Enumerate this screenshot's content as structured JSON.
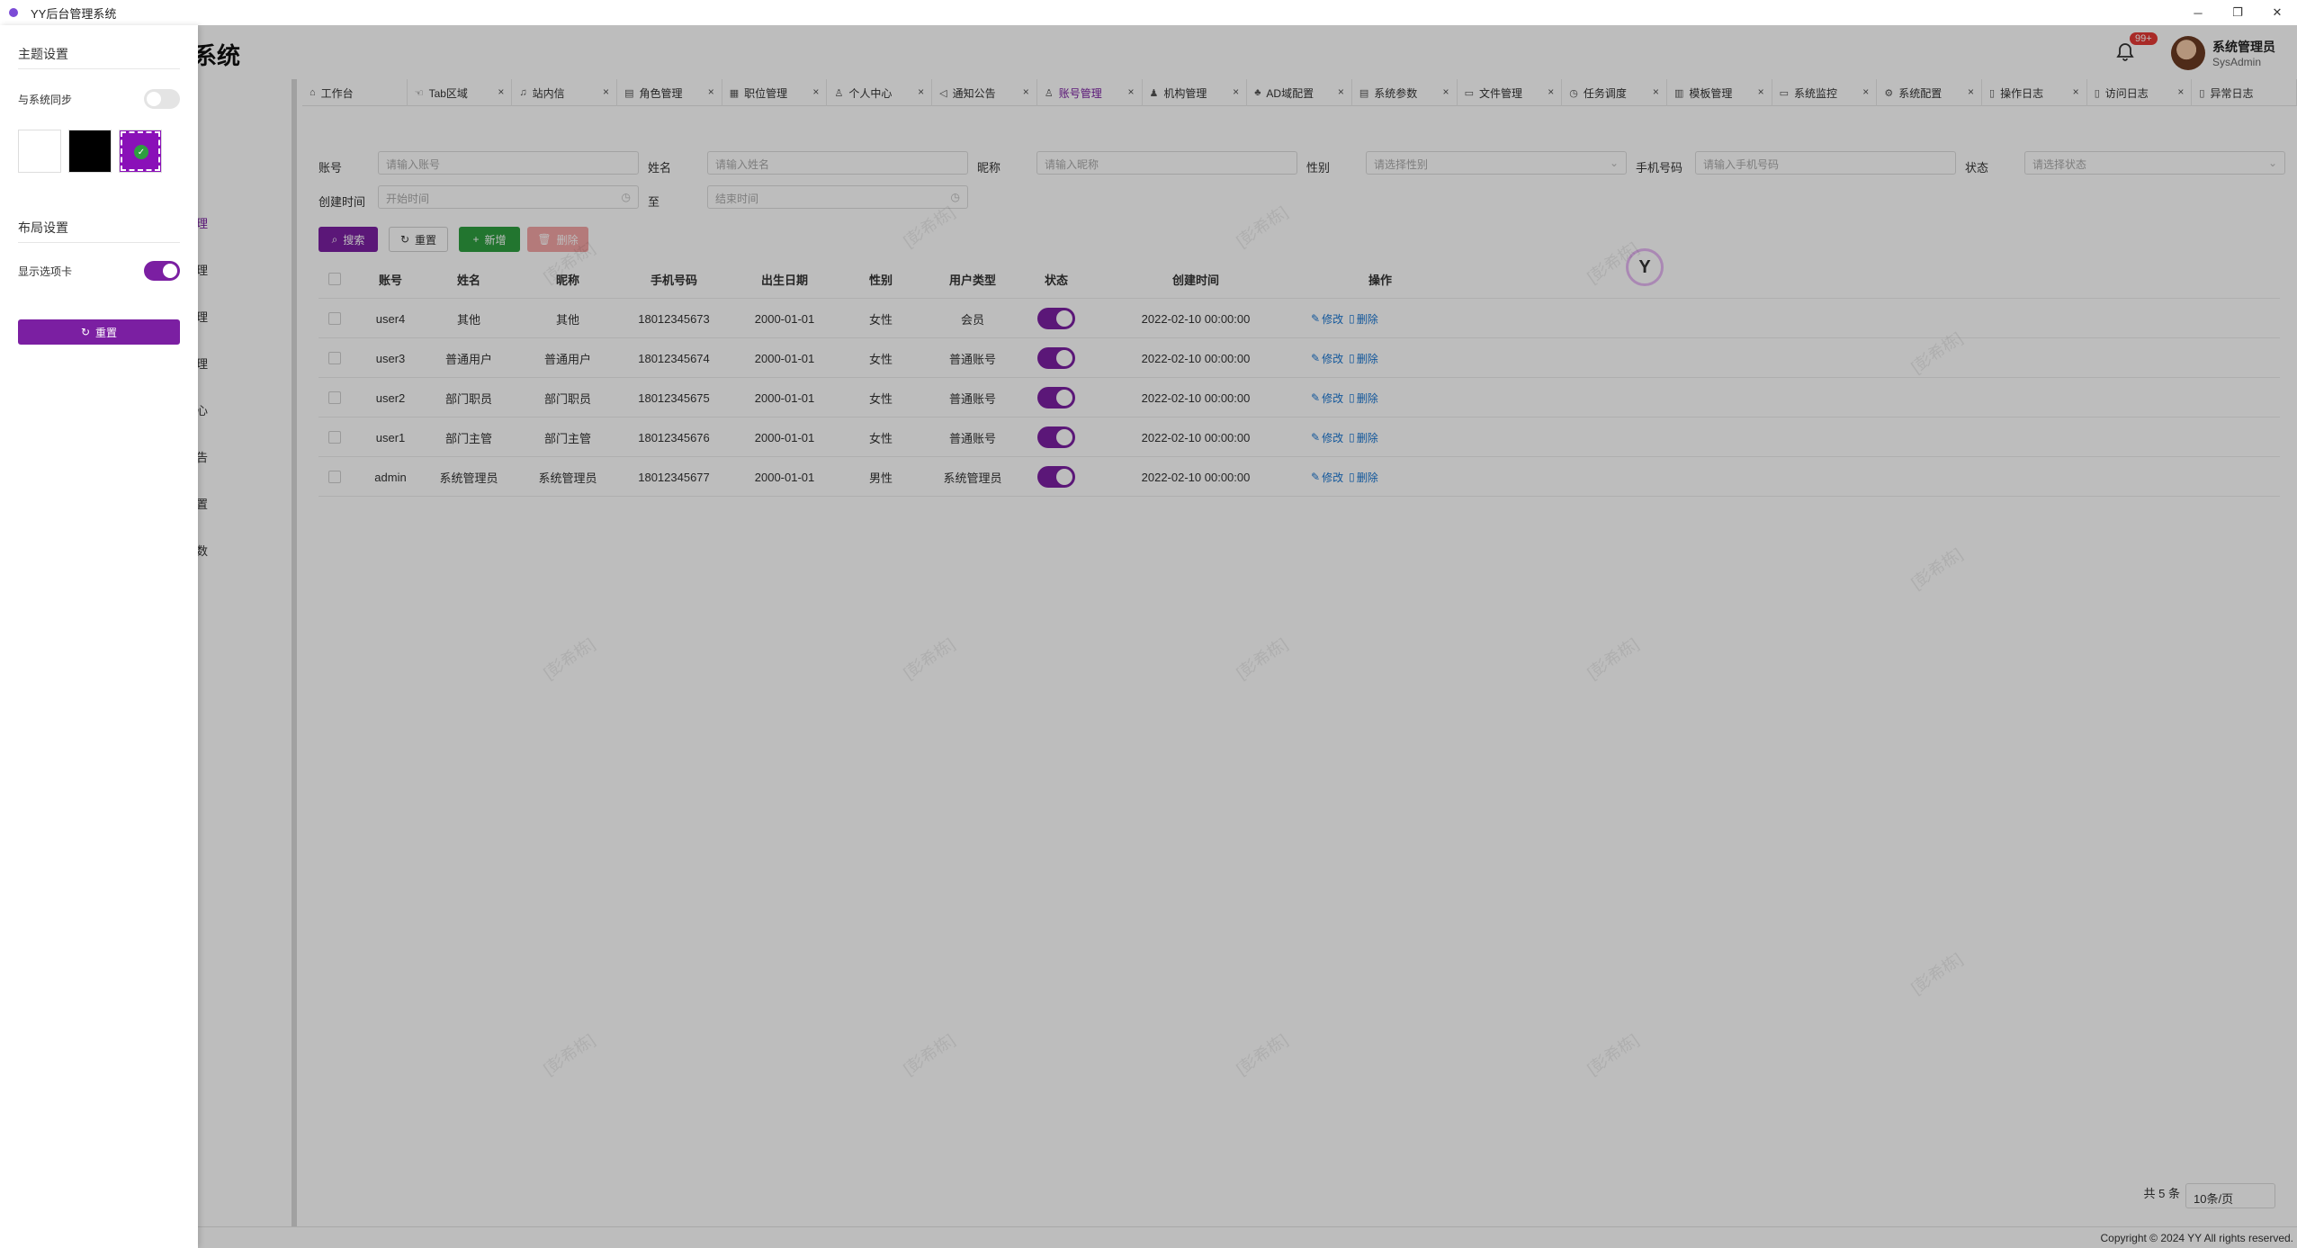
{
  "window": {
    "title": "YY后台管理系统",
    "minimize_icon": "─",
    "restore_icon": "❐",
    "close_icon": "✕"
  },
  "header": {
    "logo_text": "系统",
    "notification_badge": "99+",
    "user_name": "系统管理员",
    "user_role": "SysAdmin"
  },
  "sidebar": {
    "items": [
      "理",
      "理",
      "理",
      "理",
      "心",
      "告",
      "置",
      "数"
    ]
  },
  "tabs": [
    {
      "label": "工作台",
      "icon": "⌂",
      "closable": false,
      "active": false
    },
    {
      "label": "Tab区域",
      "icon": "☜",
      "closable": true,
      "active": false
    },
    {
      "label": "站内信",
      "icon": "♫",
      "closable": true,
      "active": false
    },
    {
      "label": "角色管理",
      "icon": "▤",
      "closable": true,
      "active": false
    },
    {
      "label": "职位管理",
      "icon": "▦",
      "closable": true,
      "active": false
    },
    {
      "label": "个人中心",
      "icon": "♙",
      "closable": true,
      "active": false
    },
    {
      "label": "通知公告",
      "icon": "◁",
      "closable": true,
      "active": false
    },
    {
      "label": "账号管理",
      "icon": "♙",
      "closable": true,
      "active": true
    },
    {
      "label": "机构管理",
      "icon": "♟",
      "closable": true,
      "active": false
    },
    {
      "label": "AD域配置",
      "icon": "♣",
      "closable": true,
      "active": false
    },
    {
      "label": "系统参数",
      "icon": "▤",
      "closable": true,
      "active": false
    },
    {
      "label": "文件管理",
      "icon": "▭",
      "closable": true,
      "active": false
    },
    {
      "label": "任务调度",
      "icon": "◷",
      "closable": true,
      "active": false
    },
    {
      "label": "模板管理",
      "icon": "▥",
      "closable": true,
      "active": false
    },
    {
      "label": "系统监控",
      "icon": "▭",
      "closable": true,
      "active": false
    },
    {
      "label": "系统配置",
      "icon": "⚙",
      "closable": true,
      "active": false
    },
    {
      "label": "操作日志",
      "icon": "▯",
      "closable": true,
      "active": false
    },
    {
      "label": "访问日志",
      "icon": "▯",
      "closable": true,
      "active": false
    },
    {
      "label": "异常日志",
      "icon": "▯",
      "closable": false,
      "active": false
    }
  ],
  "filters": {
    "account_label": "账号",
    "account_placeholder": "请输入账号",
    "name_label": "姓名",
    "name_placeholder": "请输入姓名",
    "nickname_label": "昵称",
    "nickname_placeholder": "请输入昵称",
    "gender_label": "性别",
    "gender_placeholder": "请选择性别",
    "phone_label": "手机号码",
    "phone_placeholder": "请输入手机号码",
    "status_label": "状态",
    "status_placeholder": "请选择状态",
    "created_label": "创建时间",
    "start_placeholder": "开始时间",
    "to_label": "至",
    "end_placeholder": "结束时间"
  },
  "actions": {
    "search": "搜索",
    "reset": "重置",
    "add": "新增",
    "delete": "删除"
  },
  "table": {
    "columns": [
      "账号",
      "姓名",
      "昵称",
      "手机号码",
      "出生日期",
      "性别",
      "用户类型",
      "状态",
      "创建时间",
      "操作"
    ],
    "rows": [
      {
        "account": "user4",
        "name": "其他",
        "nickname": "其他",
        "phone": "18012345673",
        "birth": "2000-01-01",
        "gender": "女性",
        "type": "会员",
        "enabled": true,
        "created": "2022-02-10 00:00:00"
      },
      {
        "account": "user3",
        "name": "普通用户",
        "nickname": "普通用户",
        "phone": "18012345674",
        "birth": "2000-01-01",
        "gender": "女性",
        "type": "普通账号",
        "enabled": true,
        "created": "2022-02-10 00:00:00"
      },
      {
        "account": "user2",
        "name": "部门职员",
        "nickname": "部门职员",
        "phone": "18012345675",
        "birth": "2000-01-01",
        "gender": "女性",
        "type": "普通账号",
        "enabled": true,
        "created": "2022-02-10 00:00:00"
      },
      {
        "account": "user1",
        "name": "部门主管",
        "nickname": "部门主管",
        "phone": "18012345676",
        "birth": "2000-01-01",
        "gender": "女性",
        "type": "普通账号",
        "enabled": true,
        "created": "2022-02-10 00:00:00"
      },
      {
        "account": "admin",
        "name": "系统管理员",
        "nickname": "系统管理员",
        "phone": "18012345677",
        "birth": "2000-01-01",
        "gender": "男性",
        "type": "系统管理员",
        "enabled": true,
        "created": "2022-02-10 00:00:00"
      }
    ],
    "edit_label": "修改",
    "delete_label": "删除"
  },
  "pagination": {
    "total": "共 5 条",
    "page_size": "10条/页"
  },
  "footer": {
    "copyright": "Copyright © 2024 YY All rights reserved."
  },
  "watermark_text": "[彭希栋]",
  "drawer": {
    "theme_title": "主题设置",
    "sync_label": "与系统同步",
    "sync_enabled": false,
    "layout_title": "布局设置",
    "show_tabs_label": "显示选项卡",
    "show_tabs_enabled": true,
    "reset_label": "重置",
    "swatches": [
      "#ffffff",
      "#000000",
      "#8a10b8"
    ],
    "selected_swatch": 2
  },
  "colors": {
    "accent": "#7b1fa2",
    "success": "#2e9e40",
    "danger_light": "#f3a5a5",
    "link": "#1976d2"
  }
}
